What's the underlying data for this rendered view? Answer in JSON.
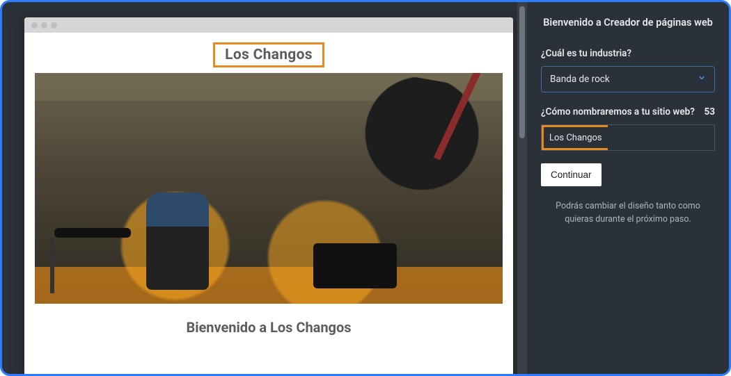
{
  "preview": {
    "site_title": "Los Changos",
    "welcome_heading": "Bienvenido a Los Changos"
  },
  "sidebar": {
    "title": "Bienvenido a Creador de páginas web",
    "industry_label": "¿Cuál es tu industria?",
    "industry_value": "Banda de rock",
    "name_label": "¿Cómo nombraremos a tu sitio web?",
    "name_char_count": "53",
    "name_value": "Los Changos",
    "continue_label": "Continuar",
    "helper_text": "Podrás cambiar el diseño tanto como quieras durante el próximo paso."
  }
}
